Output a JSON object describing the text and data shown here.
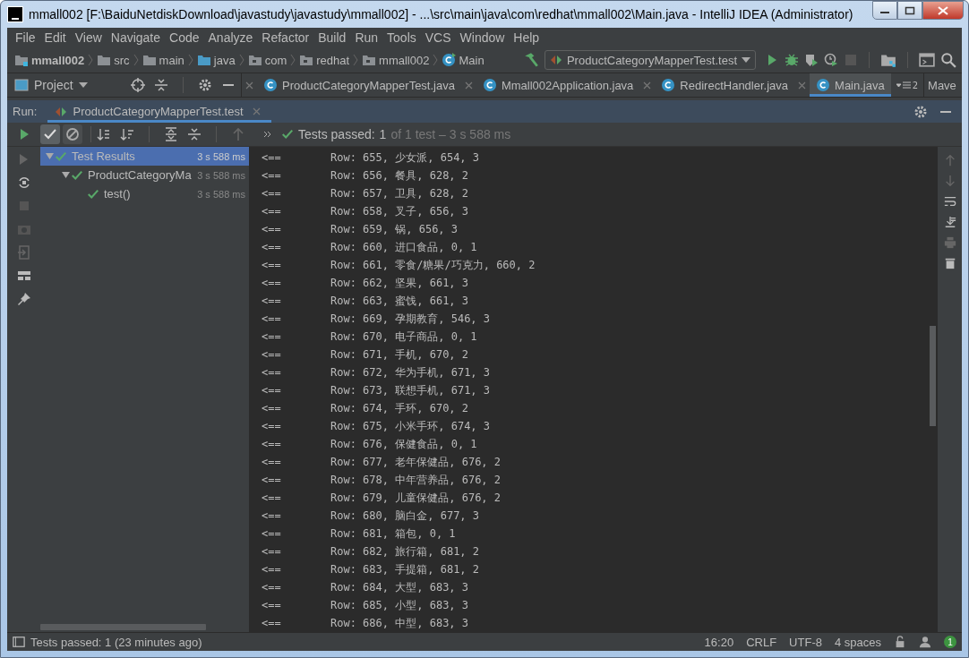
{
  "window": {
    "title": "mmall002 [F:\\BaiduNetdiskDownload\\javastudy\\javastudy\\mmall002] - ...\\src\\main\\java\\com\\redhat\\mmall002\\Main.java - IntelliJ IDEA (Administrator)"
  },
  "menu": [
    "File",
    "Edit",
    "View",
    "Navigate",
    "Code",
    "Analyze",
    "Refactor",
    "Build",
    "Run",
    "Tools",
    "VCS",
    "Window",
    "Help"
  ],
  "breadcrumbs": [
    {
      "label": "mmall002",
      "kind": "module"
    },
    {
      "label": "src",
      "kind": "folder"
    },
    {
      "label": "main",
      "kind": "folder"
    },
    {
      "label": "java",
      "kind": "source"
    },
    {
      "label": "com",
      "kind": "package"
    },
    {
      "label": "redhat",
      "kind": "package"
    },
    {
      "label": "mmall002",
      "kind": "package"
    },
    {
      "label": "Main",
      "kind": "class"
    }
  ],
  "run_config": "ProductCategoryMapperTest.test",
  "project_tool": "Project",
  "editor_tabs": [
    {
      "label": "ProductCategoryMapperTest.java",
      "selected": false,
      "closable": true
    },
    {
      "label": "Mmall002Application.java",
      "selected": false,
      "closable": true
    },
    {
      "label": "RedirectHandler.java",
      "selected": false,
      "closable": true
    },
    {
      "label": "Main.java",
      "selected": true,
      "closable": false
    }
  ],
  "tab_overflow": "2",
  "side_tab": "Mave",
  "run_panel": {
    "label": "Run:",
    "tabs": [
      {
        "label": "ProductCategoryMapperTest.test",
        "selected": true
      }
    ]
  },
  "toolbar": {
    "show_passed": {
      "on": true
    },
    "show_ignored": {
      "on": false
    },
    "status": {
      "label": "Tests passed:",
      "count": "1",
      "detail": "of 1 test – 3 s 588 ms"
    }
  },
  "tree": [
    {
      "label": "Test Results",
      "time": "3 s 588 ms",
      "selected": true,
      "expanded": true,
      "children": [
        {
          "label": "ProductCategoryMa",
          "time": "3 s 588 ms",
          "selected": false,
          "expanded": true,
          "children": [
            {
              "label": "test()",
              "time": "3 s 588 ms",
              "selected": false
            }
          ]
        }
      ]
    }
  ],
  "console": [
    {
      "prefix": "<==",
      "text": "Row: 655, 少女派, 654, 3"
    },
    {
      "prefix": "<==",
      "text": "Row: 656, 餐具, 628, 2"
    },
    {
      "prefix": "<==",
      "text": "Row: 657, 卫具, 628, 2"
    },
    {
      "prefix": "<==",
      "text": "Row: 658, 叉子, 656, 3"
    },
    {
      "prefix": "<==",
      "text": "Row: 659, 锅, 656, 3"
    },
    {
      "prefix": "<==",
      "text": "Row: 660, 进口食品, 0, 1"
    },
    {
      "prefix": "<==",
      "text": "Row: 661, 零食/糖果/巧克力, 660, 2"
    },
    {
      "prefix": "<==",
      "text": "Row: 662, 坚果, 661, 3"
    },
    {
      "prefix": "<==",
      "text": "Row: 663, 蜜饯, 661, 3"
    },
    {
      "prefix": "<==",
      "text": "Row: 669, 孕期教育, 546, 3"
    },
    {
      "prefix": "<==",
      "text": "Row: 670, 电子商品, 0, 1"
    },
    {
      "prefix": "<==",
      "text": "Row: 671, 手机, 670, 2"
    },
    {
      "prefix": "<==",
      "text": "Row: 672, 华为手机, 671, 3"
    },
    {
      "prefix": "<==",
      "text": "Row: 673, 联想手机, 671, 3"
    },
    {
      "prefix": "<==",
      "text": "Row: 674, 手环, 670, 2"
    },
    {
      "prefix": "<==",
      "text": "Row: 675, 小米手环, 674, 3"
    },
    {
      "prefix": "<==",
      "text": "Row: 676, 保健食品, 0, 1"
    },
    {
      "prefix": "<==",
      "text": "Row: 677, 老年保健品, 676, 2"
    },
    {
      "prefix": "<==",
      "text": "Row: 678, 中年营养品, 676, 2"
    },
    {
      "prefix": "<==",
      "text": "Row: 679, 儿童保健品, 676, 2"
    },
    {
      "prefix": "<==",
      "text": "Row: 680, 脑白金, 677, 3"
    },
    {
      "prefix": "<==",
      "text": "Row: 681, 箱包, 0, 1"
    },
    {
      "prefix": "<==",
      "text": "Row: 682, 旅行箱, 681, 2"
    },
    {
      "prefix": "<==",
      "text": "Row: 683, 手提箱, 681, 2"
    },
    {
      "prefix": "<==",
      "text": "Row: 684, 大型, 683, 3"
    },
    {
      "prefix": "<==",
      "text": "Row: 685, 小型, 683, 3"
    },
    {
      "prefix": "<==",
      "text": "Row: 686, 中型, 683, 3"
    }
  ],
  "status_bar": {
    "message": "Tests passed: 1 (23 minutes ago)",
    "items": [
      "16:20",
      "CRLF",
      "UTF-8",
      "4 spaces"
    ],
    "notifications": "1"
  }
}
